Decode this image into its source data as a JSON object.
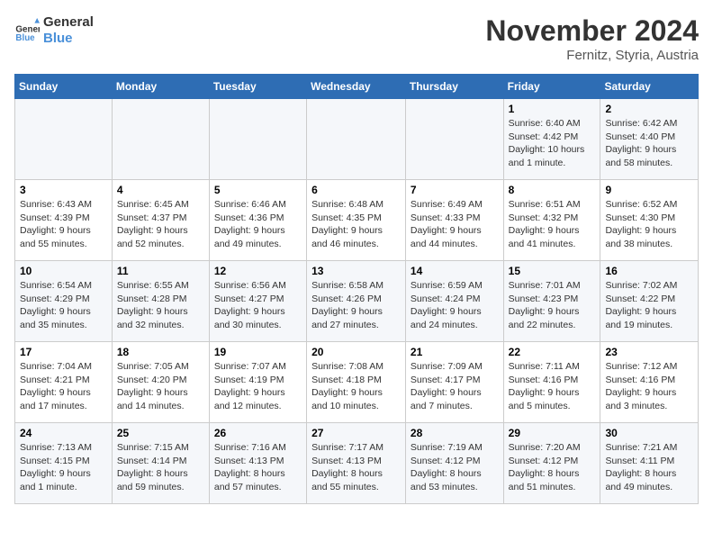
{
  "logo": {
    "line1": "General",
    "line2": "Blue"
  },
  "title": "November 2024",
  "subtitle": "Fernitz, Styria, Austria",
  "days_of_week": [
    "Sunday",
    "Monday",
    "Tuesday",
    "Wednesday",
    "Thursday",
    "Friday",
    "Saturday"
  ],
  "weeks": [
    [
      {
        "day": "",
        "info": ""
      },
      {
        "day": "",
        "info": ""
      },
      {
        "day": "",
        "info": ""
      },
      {
        "day": "",
        "info": ""
      },
      {
        "day": "",
        "info": ""
      },
      {
        "day": "1",
        "info": "Sunrise: 6:40 AM\nSunset: 4:42 PM\nDaylight: 10 hours and 1 minute."
      },
      {
        "day": "2",
        "info": "Sunrise: 6:42 AM\nSunset: 4:40 PM\nDaylight: 9 hours and 58 minutes."
      }
    ],
    [
      {
        "day": "3",
        "info": "Sunrise: 6:43 AM\nSunset: 4:39 PM\nDaylight: 9 hours and 55 minutes."
      },
      {
        "day": "4",
        "info": "Sunrise: 6:45 AM\nSunset: 4:37 PM\nDaylight: 9 hours and 52 minutes."
      },
      {
        "day": "5",
        "info": "Sunrise: 6:46 AM\nSunset: 4:36 PM\nDaylight: 9 hours and 49 minutes."
      },
      {
        "day": "6",
        "info": "Sunrise: 6:48 AM\nSunset: 4:35 PM\nDaylight: 9 hours and 46 minutes."
      },
      {
        "day": "7",
        "info": "Sunrise: 6:49 AM\nSunset: 4:33 PM\nDaylight: 9 hours and 44 minutes."
      },
      {
        "day": "8",
        "info": "Sunrise: 6:51 AM\nSunset: 4:32 PM\nDaylight: 9 hours and 41 minutes."
      },
      {
        "day": "9",
        "info": "Sunrise: 6:52 AM\nSunset: 4:30 PM\nDaylight: 9 hours and 38 minutes."
      }
    ],
    [
      {
        "day": "10",
        "info": "Sunrise: 6:54 AM\nSunset: 4:29 PM\nDaylight: 9 hours and 35 minutes."
      },
      {
        "day": "11",
        "info": "Sunrise: 6:55 AM\nSunset: 4:28 PM\nDaylight: 9 hours and 32 minutes."
      },
      {
        "day": "12",
        "info": "Sunrise: 6:56 AM\nSunset: 4:27 PM\nDaylight: 9 hours and 30 minutes."
      },
      {
        "day": "13",
        "info": "Sunrise: 6:58 AM\nSunset: 4:26 PM\nDaylight: 9 hours and 27 minutes."
      },
      {
        "day": "14",
        "info": "Sunrise: 6:59 AM\nSunset: 4:24 PM\nDaylight: 9 hours and 24 minutes."
      },
      {
        "day": "15",
        "info": "Sunrise: 7:01 AM\nSunset: 4:23 PM\nDaylight: 9 hours and 22 minutes."
      },
      {
        "day": "16",
        "info": "Sunrise: 7:02 AM\nSunset: 4:22 PM\nDaylight: 9 hours and 19 minutes."
      }
    ],
    [
      {
        "day": "17",
        "info": "Sunrise: 7:04 AM\nSunset: 4:21 PM\nDaylight: 9 hours and 17 minutes."
      },
      {
        "day": "18",
        "info": "Sunrise: 7:05 AM\nSunset: 4:20 PM\nDaylight: 9 hours and 14 minutes."
      },
      {
        "day": "19",
        "info": "Sunrise: 7:07 AM\nSunset: 4:19 PM\nDaylight: 9 hours and 12 minutes."
      },
      {
        "day": "20",
        "info": "Sunrise: 7:08 AM\nSunset: 4:18 PM\nDaylight: 9 hours and 10 minutes."
      },
      {
        "day": "21",
        "info": "Sunrise: 7:09 AM\nSunset: 4:17 PM\nDaylight: 9 hours and 7 minutes."
      },
      {
        "day": "22",
        "info": "Sunrise: 7:11 AM\nSunset: 4:16 PM\nDaylight: 9 hours and 5 minutes."
      },
      {
        "day": "23",
        "info": "Sunrise: 7:12 AM\nSunset: 4:16 PM\nDaylight: 9 hours and 3 minutes."
      }
    ],
    [
      {
        "day": "24",
        "info": "Sunrise: 7:13 AM\nSunset: 4:15 PM\nDaylight: 9 hours and 1 minute."
      },
      {
        "day": "25",
        "info": "Sunrise: 7:15 AM\nSunset: 4:14 PM\nDaylight: 8 hours and 59 minutes."
      },
      {
        "day": "26",
        "info": "Sunrise: 7:16 AM\nSunset: 4:13 PM\nDaylight: 8 hours and 57 minutes."
      },
      {
        "day": "27",
        "info": "Sunrise: 7:17 AM\nSunset: 4:13 PM\nDaylight: 8 hours and 55 minutes."
      },
      {
        "day": "28",
        "info": "Sunrise: 7:19 AM\nSunset: 4:12 PM\nDaylight: 8 hours and 53 minutes."
      },
      {
        "day": "29",
        "info": "Sunrise: 7:20 AM\nSunset: 4:12 PM\nDaylight: 8 hours and 51 minutes."
      },
      {
        "day": "30",
        "info": "Sunrise: 7:21 AM\nSunset: 4:11 PM\nDaylight: 8 hours and 49 minutes."
      }
    ]
  ]
}
